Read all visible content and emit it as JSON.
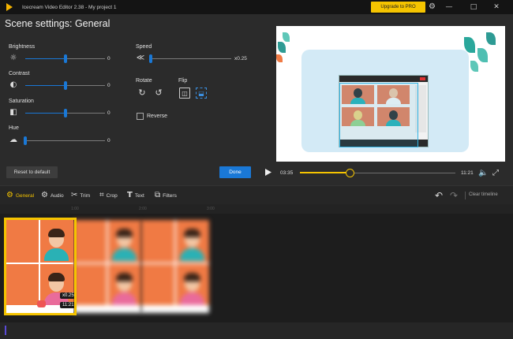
{
  "window": {
    "title": "Icecream Video Editor 2.38  -  My project 1",
    "upgrade_label": "Upgrade to PRO",
    "minimize": "—",
    "maximize": "□",
    "close": "✕"
  },
  "settings": {
    "title": "Scene settings: General",
    "brightness": {
      "label": "Brightness",
      "value": "0",
      "level": 0.5
    },
    "contrast": {
      "label": "Contrast",
      "value": "0",
      "level": 0.5
    },
    "saturation": {
      "label": "Saturation",
      "value": "0",
      "level": 0.5
    },
    "hue": {
      "label": "Hue",
      "value": "0",
      "level": 0.0
    },
    "speed": {
      "label": "Speed",
      "value": "x0.25",
      "level": 0.0
    },
    "rotate_label": "Rotate",
    "flip_label": "Flip",
    "reverse_label": "Reverse",
    "reset_label": "Reset to default",
    "done_label": "Done"
  },
  "player": {
    "current_time": "03:35",
    "total_time": "11:21",
    "progress": 0.32
  },
  "toolbar": {
    "tools": [
      {
        "label": "General",
        "active": true
      },
      {
        "label": "Audio"
      },
      {
        "label": "Trim"
      },
      {
        "label": "Crop"
      },
      {
        "label": "Text"
      },
      {
        "label": "Filters"
      }
    ],
    "clear_label": "Clear timeline"
  },
  "timeline": {
    "ruler_ticks": [
      "1:00",
      "2:00",
      "3:00"
    ],
    "clip": {
      "speed": "x0.25",
      "duration": "11:21"
    }
  },
  "colors": {
    "accent_blue": "#1a78d6",
    "accent_yellow": "#f5c400",
    "clip_orange": "#f07a44"
  }
}
